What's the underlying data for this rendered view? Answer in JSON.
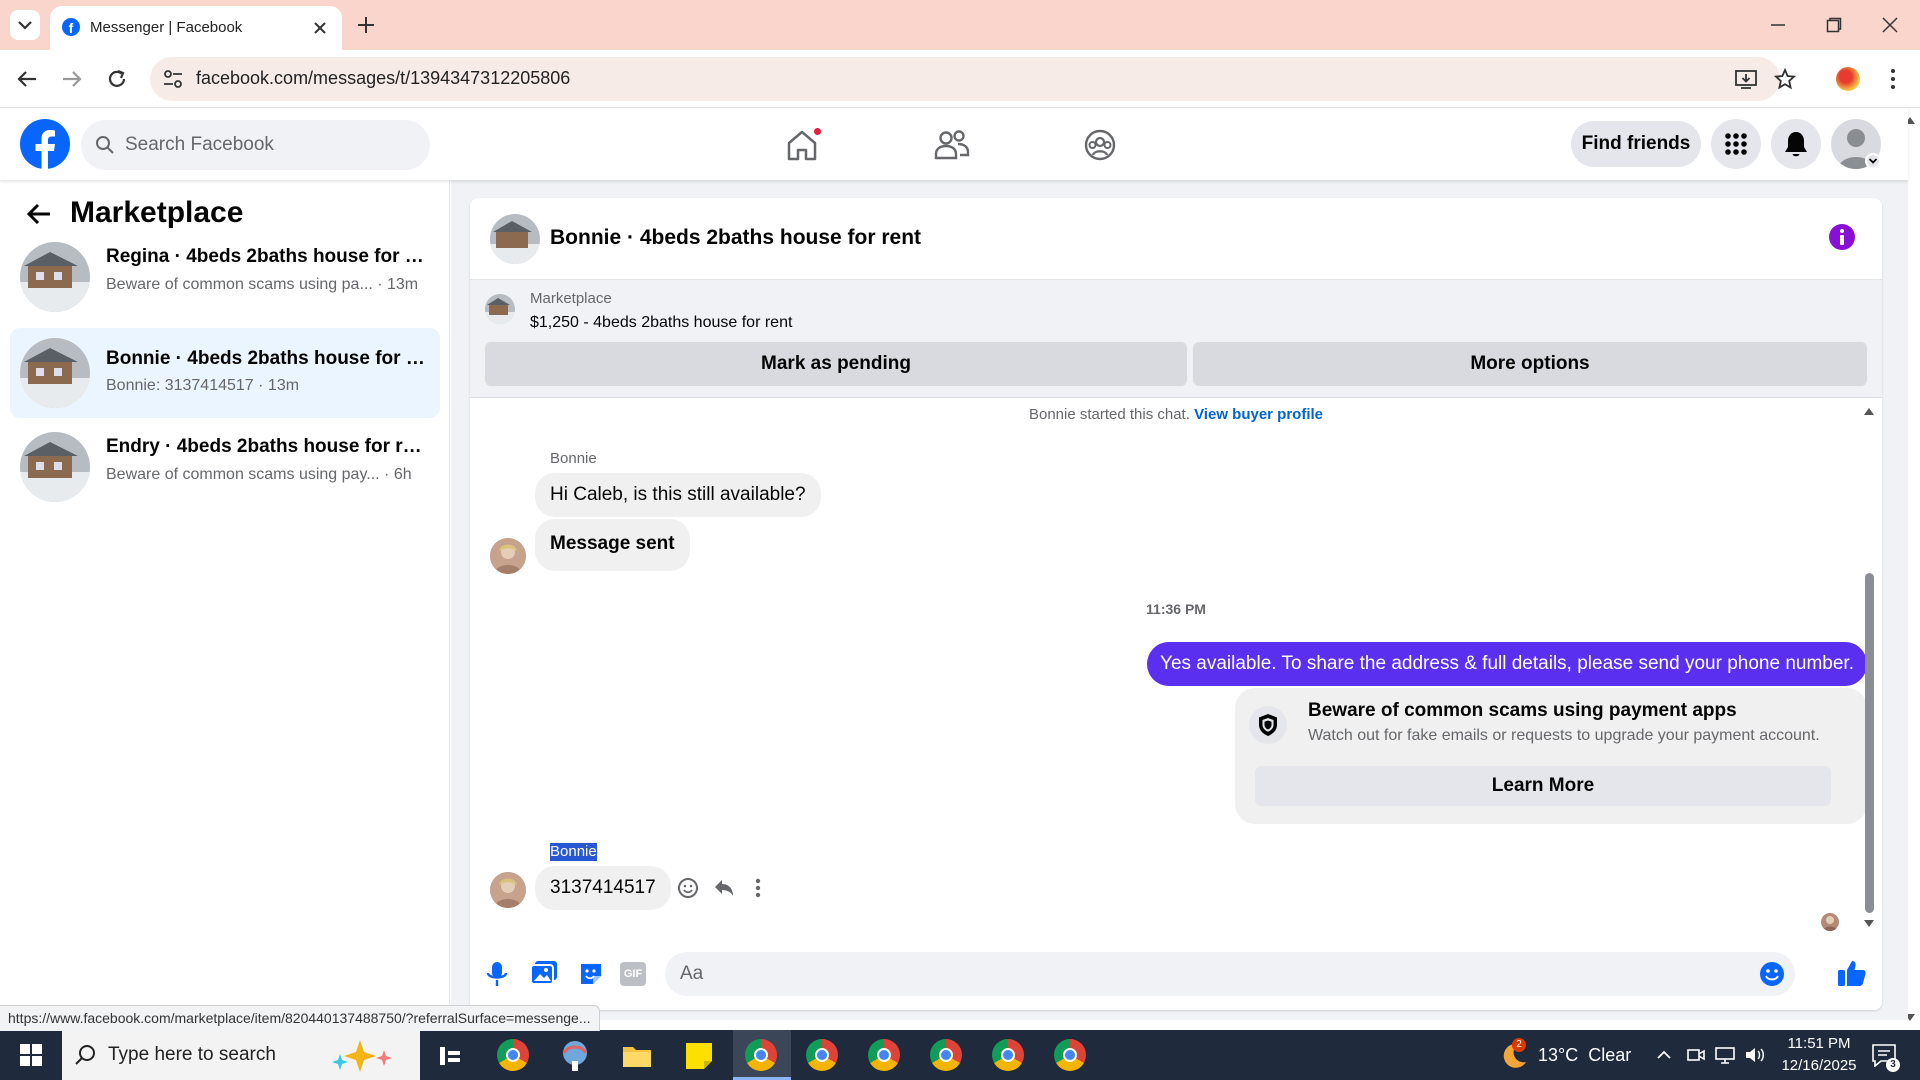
{
  "browser": {
    "tab_title": "Messenger | Facebook",
    "url": "facebook.com/messages/t/1394347312205806",
    "status_url": "https://www.facebook.com/marketplace/item/820440137488750/?referralSurface=messenge..."
  },
  "header": {
    "search_placeholder": "Search Facebook",
    "find_friends_label": "Find friends"
  },
  "sidebar": {
    "title": "Marketplace",
    "conversations": [
      {
        "title": "Regina · 4beds 2baths house for re...",
        "preview": "Beware of common scams using pa...",
        "time": "· 13m",
        "selected": false
      },
      {
        "title": "Bonnie · 4beds 2baths house for r...",
        "preview": "Bonnie: 3137414517",
        "time": "· 13m",
        "selected": true
      },
      {
        "title": "Endry · 4beds 2baths house for rent",
        "preview": "Beware of common scams using pay...",
        "time": "· 6h",
        "selected": false
      }
    ]
  },
  "chat": {
    "header_title": "Bonnie · 4beds 2baths house for rent",
    "listing": {
      "label": "Marketplace",
      "description": "$1,250 - 4beds 2baths house for rent",
      "mark_pending_label": "Mark as pending",
      "more_options_label": "More options"
    },
    "started_text": "Bonnie started this chat.",
    "view_buyer_label": "View buyer profile",
    "sender_name": "Bonnie",
    "messages_in_1": [
      "Hi Caleb, is this still available?",
      "Message sent"
    ],
    "timestamp": "11:36 PM",
    "message_out": "Yes available. To share the address & full details, please send your phone number.",
    "scam_card": {
      "title": "Beware of common scams using payment apps",
      "body": "Watch out for fake emails or requests to upgrade your payment account.",
      "button": "Learn More"
    },
    "sender_name_2": "Bonnie",
    "message_in_2": "3137414517",
    "composer_placeholder": "Aa"
  },
  "taskbar": {
    "search_placeholder": "Type here to search",
    "weather": "13°C  Clear",
    "weather_badge": "2",
    "time": "11:51 PM",
    "date": "12/16/2025",
    "notifications": "3"
  },
  "colors": {
    "fb_blue": "#0866ff",
    "outgoing_bubble": "#5b2ff0",
    "tabbar": "#f9d5cc",
    "taskbar": "#1f2a3c"
  }
}
